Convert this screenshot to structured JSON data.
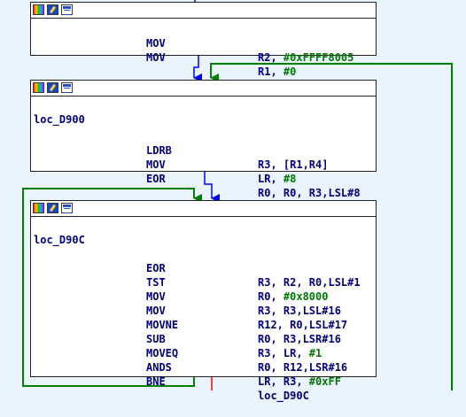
{
  "colors": {
    "background": "#e9f4ff",
    "edge_normal": "#0000ff",
    "edge_true": "#008000",
    "edge_false": "#ff0000"
  },
  "header_icons": [
    "color-palette-icon",
    "graph-view-icon",
    "text-view-icon"
  ],
  "nodes": [
    {
      "id": "block-1",
      "label": "",
      "lines": [
        {
          "mnemonic": "MOV",
          "op_a": "R2, ",
          "op_imm": "#0xFFFF8005"
        },
        {
          "mnemonic": "MOV",
          "op_a": "R1, ",
          "op_imm": "#0"
        }
      ]
    },
    {
      "id": "block-2",
      "label": "loc_D900",
      "lines": [
        {
          "mnemonic": "LDRB",
          "op_a": "R3, [R1,R4]",
          "op_imm": ""
        },
        {
          "mnemonic": "MOV",
          "op_a": "LR, ",
          "op_imm": "#8"
        },
        {
          "mnemonic": "EOR",
          "op_a": "R0, R0, R3,LSL#8",
          "op_imm": ""
        }
      ]
    },
    {
      "id": "block-3",
      "label": "loc_D90C",
      "lines": [
        {
          "mnemonic": "EOR",
          "op_a": "R3, R2, R0,LSL#1",
          "op_imm": ""
        },
        {
          "mnemonic": "TST",
          "op_a": "R0, ",
          "op_imm": "#0x8000"
        },
        {
          "mnemonic": "MOV",
          "op_a": "R3, R3,LSL#16",
          "op_imm": ""
        },
        {
          "mnemonic": "MOV",
          "op_a": "R12, R0,LSL#17",
          "op_imm": ""
        },
        {
          "mnemonic": "MOVNE",
          "op_a": "R0, R3,LSR#16",
          "op_imm": ""
        },
        {
          "mnemonic": "SUB",
          "op_a": "R3, LR, ",
          "op_imm": "#1"
        },
        {
          "mnemonic": "MOVEQ",
          "op_a": "R0, R12,LSR#16",
          "op_imm": ""
        },
        {
          "mnemonic": "ANDS",
          "op_a": "LR, R3, ",
          "op_imm": "#0xFF"
        },
        {
          "mnemonic": "BNE",
          "op_a": "loc_D90C",
          "op_imm": ""
        }
      ]
    }
  ]
}
